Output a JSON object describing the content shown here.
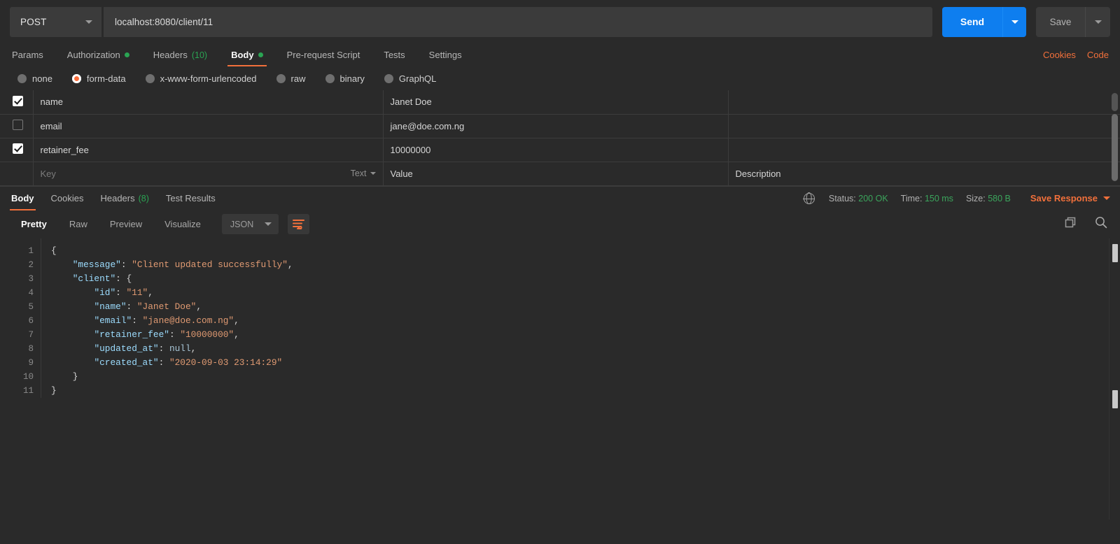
{
  "request": {
    "method": "POST",
    "url": "localhost:8080/client/11",
    "send_label": "Send",
    "save_label": "Save",
    "tabs": [
      {
        "label": "Params",
        "indicator": "none",
        "active": false
      },
      {
        "label": "Authorization",
        "indicator": "dot",
        "active": false
      },
      {
        "label": "Headers",
        "indicator": "count",
        "count": "(10)",
        "active": false
      },
      {
        "label": "Body",
        "indicator": "dot",
        "active": true
      },
      {
        "label": "Pre-request Script",
        "indicator": "none",
        "active": false
      },
      {
        "label": "Tests",
        "indicator": "none",
        "active": false
      },
      {
        "label": "Settings",
        "indicator": "none",
        "active": false
      }
    ],
    "cookies_link": "Cookies",
    "code_link": "Code"
  },
  "body_types": [
    {
      "label": "none",
      "selected": false
    },
    {
      "label": "form-data",
      "selected": true
    },
    {
      "label": "x-www-form-urlencoded",
      "selected": false
    },
    {
      "label": "raw",
      "selected": false
    },
    {
      "label": "binary",
      "selected": false
    },
    {
      "label": "GraphQL",
      "selected": false
    }
  ],
  "form_data": {
    "rows": [
      {
        "checked": true,
        "key": "name",
        "value": "Janet Doe",
        "description": "",
        "muted": false
      },
      {
        "checked": false,
        "key": "email",
        "value": "jane@doe.com.ng",
        "description": "",
        "muted": true
      },
      {
        "checked": true,
        "key": "retainer_fee",
        "value": "10000000",
        "description": "",
        "muted": false
      }
    ],
    "new_row": {
      "key_placeholder": "Key",
      "value_placeholder": "Value",
      "description_placeholder": "Description",
      "type_label": "Text"
    }
  },
  "response": {
    "tabs": [
      {
        "label": "Body",
        "active": true
      },
      {
        "label": "Cookies",
        "active": false
      },
      {
        "label": "Headers",
        "count": "(8)",
        "active": false
      },
      {
        "label": "Test Results",
        "active": false
      }
    ],
    "status_label": "Status:",
    "status_value": "200 OK",
    "time_label": "Time:",
    "time_value": "150 ms",
    "size_label": "Size:",
    "size_value": "580 B",
    "save_response": "Save Response",
    "view_tabs": [
      {
        "label": "Pretty",
        "active": true
      },
      {
        "label": "Raw",
        "active": false
      },
      {
        "label": "Preview",
        "active": false
      },
      {
        "label": "Visualize",
        "active": false
      }
    ],
    "format": "JSON",
    "line_numbers": [
      "1",
      "2",
      "3",
      "4",
      "5",
      "6",
      "7",
      "8",
      "9",
      "10",
      "11"
    ],
    "lines": [
      [
        {
          "t": "pun",
          "v": "{"
        }
      ],
      [
        {
          "t": "pun",
          "v": "    "
        },
        {
          "t": "key",
          "v": "\"message\""
        },
        {
          "t": "pun",
          "v": ": "
        },
        {
          "t": "str",
          "v": "\"Client updated successfully\""
        },
        {
          "t": "pun",
          "v": ","
        }
      ],
      [
        {
          "t": "pun",
          "v": "    "
        },
        {
          "t": "key",
          "v": "\"client\""
        },
        {
          "t": "pun",
          "v": ": {"
        }
      ],
      [
        {
          "t": "pun",
          "v": "        "
        },
        {
          "t": "key",
          "v": "\"id\""
        },
        {
          "t": "pun",
          "v": ": "
        },
        {
          "t": "str",
          "v": "\"11\""
        },
        {
          "t": "pun",
          "v": ","
        }
      ],
      [
        {
          "t": "pun",
          "v": "        "
        },
        {
          "t": "key",
          "v": "\"name\""
        },
        {
          "t": "pun",
          "v": ": "
        },
        {
          "t": "str",
          "v": "\"Janet Doe\""
        },
        {
          "t": "pun",
          "v": ","
        }
      ],
      [
        {
          "t": "pun",
          "v": "        "
        },
        {
          "t": "key",
          "v": "\"email\""
        },
        {
          "t": "pun",
          "v": ": "
        },
        {
          "t": "str",
          "v": "\"jane@doe.com.ng\""
        },
        {
          "t": "pun",
          "v": ","
        }
      ],
      [
        {
          "t": "pun",
          "v": "        "
        },
        {
          "t": "key",
          "v": "\"retainer_fee\""
        },
        {
          "t": "pun",
          "v": ": "
        },
        {
          "t": "str",
          "v": "\"10000000\""
        },
        {
          "t": "pun",
          "v": ","
        }
      ],
      [
        {
          "t": "pun",
          "v": "        "
        },
        {
          "t": "key",
          "v": "\"updated_at\""
        },
        {
          "t": "pun",
          "v": ": "
        },
        {
          "t": "null",
          "v": "null"
        },
        {
          "t": "pun",
          "v": ","
        }
      ],
      [
        {
          "t": "pun",
          "v": "        "
        },
        {
          "t": "key",
          "v": "\"created_at\""
        },
        {
          "t": "pun",
          "v": ": "
        },
        {
          "t": "str",
          "v": "\"2020-09-03 23:14:29\""
        }
      ],
      [
        {
          "t": "pun",
          "v": "    }"
        }
      ],
      [
        {
          "t": "pun",
          "v": "}"
        }
      ]
    ]
  },
  "colors": {
    "accent_orange": "#f2703b",
    "send_blue": "#0e7eef",
    "status_green": "#3ba55c",
    "background": "#2a2a2a"
  }
}
